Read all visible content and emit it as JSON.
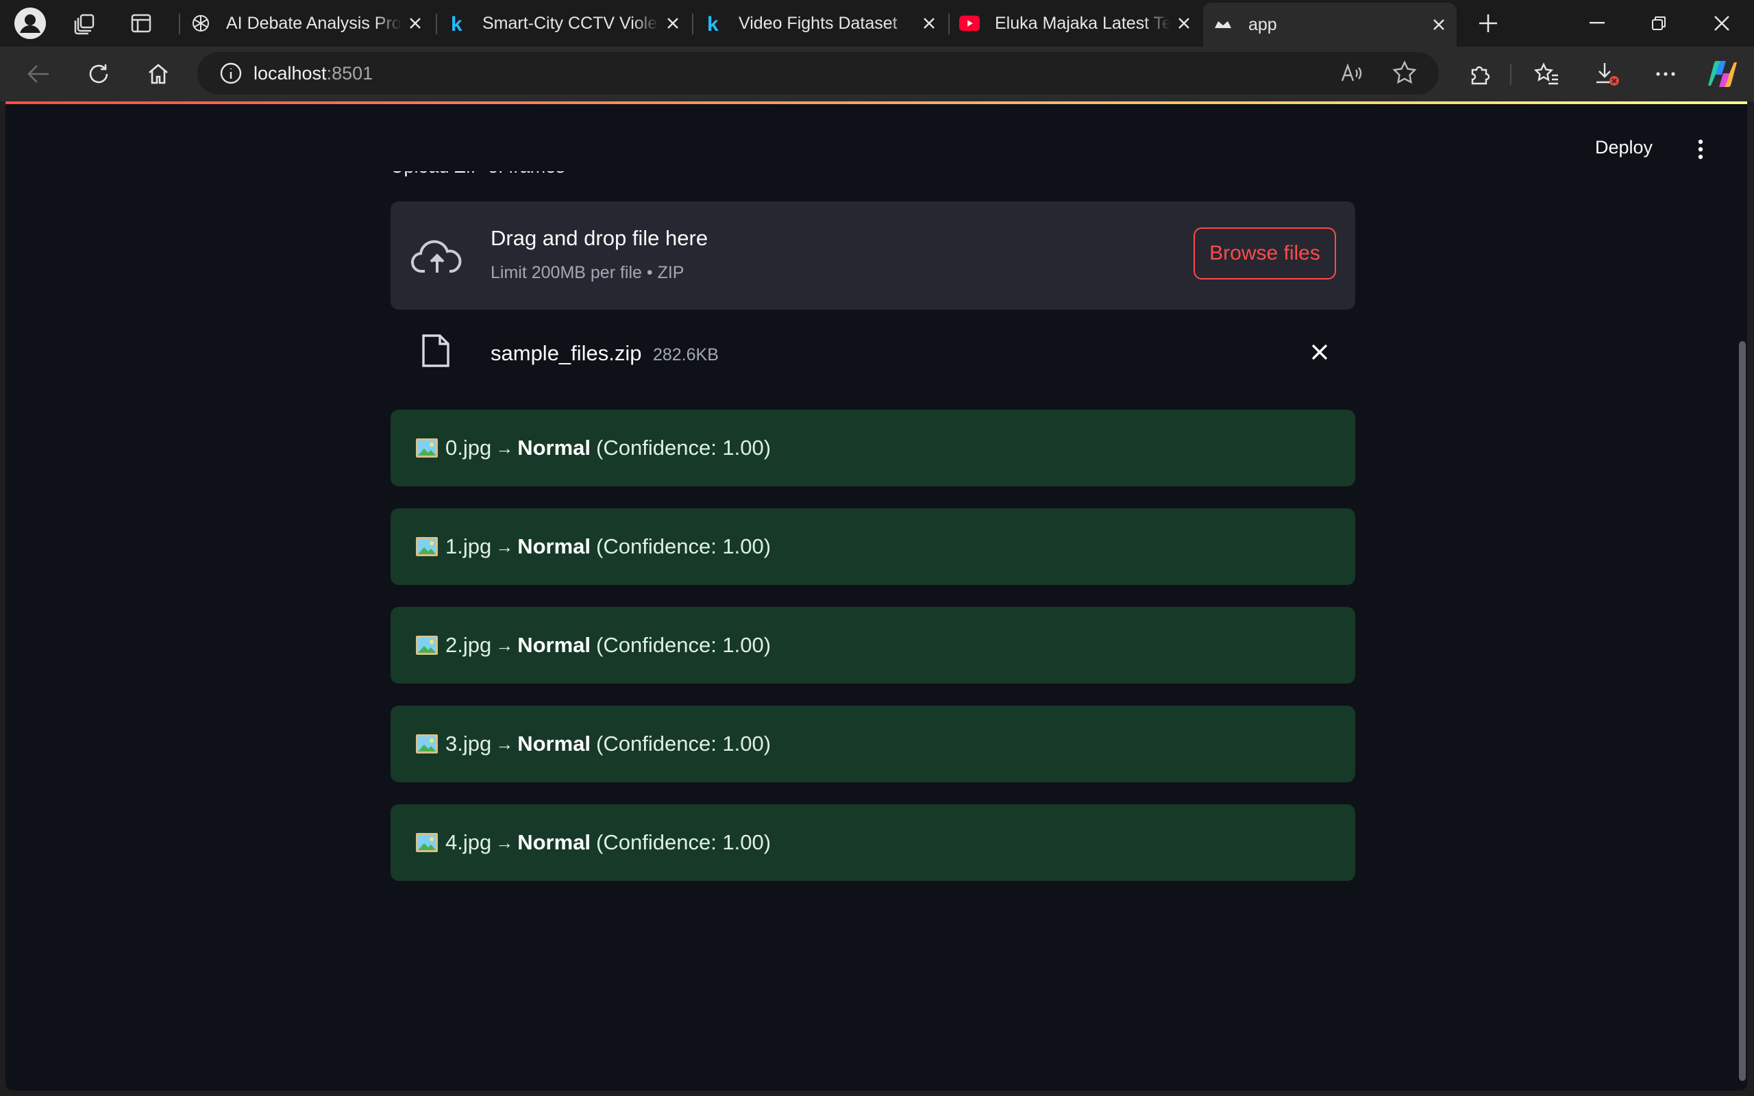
{
  "browser": {
    "tabs": [
      {
        "title": "AI Debate Analysis Proje",
        "favicon": "openai-icon"
      },
      {
        "title": "Smart-City CCTV Violenc",
        "favicon": "kaggle-icon"
      },
      {
        "title": "Video Fights Dataset",
        "favicon": "kaggle-icon"
      },
      {
        "title": "Eluka Majaka Latest Telu",
        "favicon": "youtube-icon"
      },
      {
        "title": "app",
        "favicon": "streamlit-icon"
      }
    ],
    "url_host": "localhost",
    "url_port": ":8501"
  },
  "header": {
    "deploy_label": "Deploy"
  },
  "uploader": {
    "label": "Upload ZIP of frames",
    "drop_title": "Drag and drop file here",
    "drop_sub": "Limit 200MB per file • ZIP",
    "browse_label": "Browse files",
    "file_name": "sample_files.zip",
    "file_size": "282.6KB"
  },
  "results": [
    {
      "file": "0.jpg",
      "arrow": "→",
      "label": "Normal",
      "confidence": "(Confidence: 1.00)"
    },
    {
      "file": "1.jpg",
      "arrow": "→",
      "label": "Normal",
      "confidence": "(Confidence: 1.00)"
    },
    {
      "file": "2.jpg",
      "arrow": "→",
      "label": "Normal",
      "confidence": "(Confidence: 1.00)"
    },
    {
      "file": "3.jpg",
      "arrow": "→",
      "label": "Normal",
      "confidence": "(Confidence: 1.00)"
    },
    {
      "file": "4.jpg",
      "arrow": "→",
      "label": "Normal",
      "confidence": "(Confidence: 1.00)"
    }
  ],
  "colors": {
    "page_bg": "#0e1117",
    "accent": "#ff4b4b",
    "success_bg": "#173928",
    "dropzone_bg": "#262730"
  }
}
